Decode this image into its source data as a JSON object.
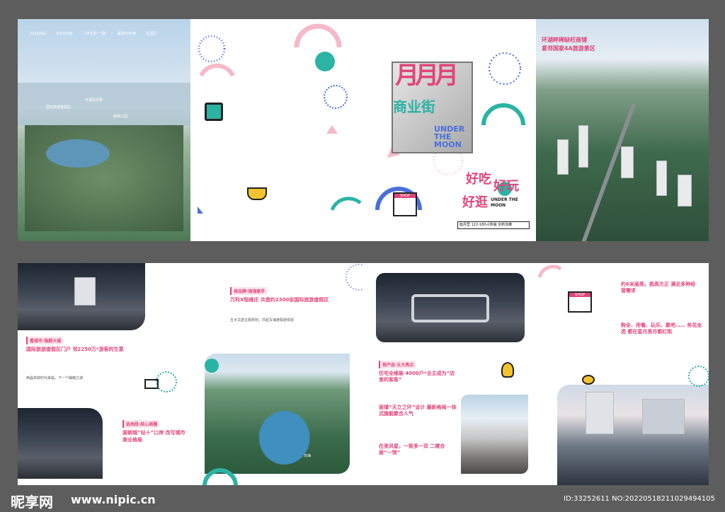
{
  "colors": {
    "accent": "#e1457a",
    "teal": "#2bb3a4",
    "blue": "#4a6fdc",
    "pink_light": "#f5b9c9"
  },
  "top": {
    "stats": [
      "约2200㎡",
      "约3300套",
      "二环仓及“一路”",
      "蔓湖30分钟",
      "生活区"
    ],
    "overlay_labels": [
      "国际旅游度假区",
      "环湖风光带",
      "森林公园"
    ],
    "cover": {
      "headline": "月月月",
      "sub": "商业街",
      "english": "UNDER THE MOON",
      "slogan_a": "好吃",
      "slogan_b": "好玩",
      "slogan_c": "好逛",
      "tag": "UNDER THE MOON",
      "bottom_bar": "面月里 122-180㎡商铺 全新加推",
      "shop": "SHOP"
    },
    "right_title_1": "环湖畔稀缺旺商铺",
    "right_title_2": "紧邻国家4A旅游景区"
  },
  "bottom": {
    "p1_heading": "看城市·临蔚大城",
    "p1_title": "国际旅游度假区门户 邻2250万*游客的生意",
    "p1_caption": "西昌高铁时代来临，下一个蝴蝶之城",
    "p1_tag2": "选地段·核心商圈",
    "p1_title2": "面朝城“站十”口岸 改写城市商业格局",
    "p2_heading": "择品牌·强强联手",
    "p2_title": "万科X恒维庄 共造约2300亩国际旅游度假区",
    "p2_line": "五大文旅主题规划，共起写海度假游体验",
    "p2_lake": "邛海",
    "p3_heading": "观产品·五大亮点",
    "p3_title": "住宅全维装 4000户*业主成为“店里的客客”",
    "p3_title2": "面铺“天立之环”设计 最新格局一体式旗舰聚合人气",
    "p3_title3": "在里风星，一街多一双 二楼合层“一馆”",
    "p4_title": "约6米层高，挑高方正 满足多种经营需求",
    "p4_title2": "购全、用餐、玩乐、聚吧…… 务花全选 都在星月里月都红街",
    "shop": "SHOP"
  },
  "watermark": {
    "logo": "昵享网",
    "url": "www.nipic.cn",
    "id_line": "ID:33252611 NO:20220518211029494105"
  }
}
